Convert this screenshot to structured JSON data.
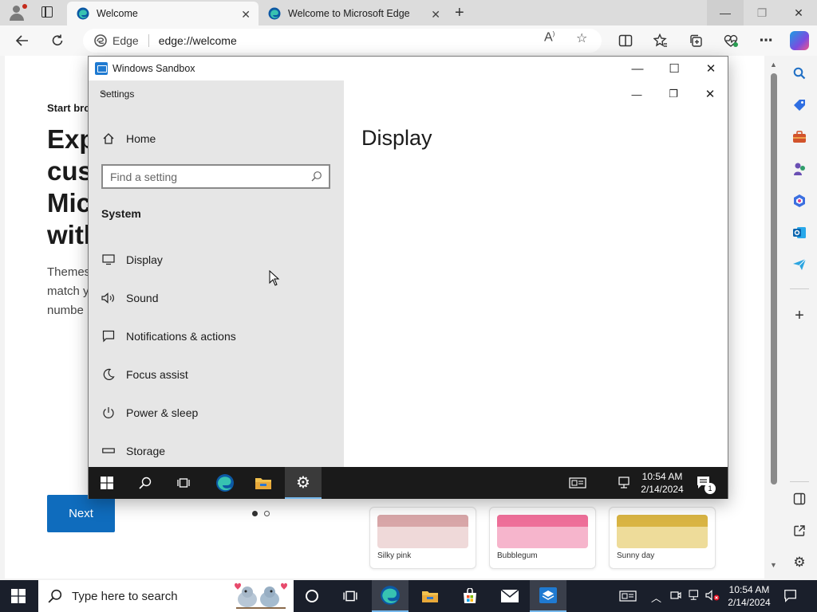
{
  "browser": {
    "tabs": [
      {
        "title": "Welcome",
        "active": true
      },
      {
        "title": "Welcome to Microsoft Edge",
        "active": false
      }
    ],
    "address": {
      "site_label": "Edge",
      "url": "edge://welcome"
    },
    "window_controls": {
      "minimize": "—",
      "restore": "❐",
      "close": "✕"
    }
  },
  "welcome_page": {
    "kicker": "Start bro",
    "hero_lines": [
      "Exp",
      "cust",
      "Mic",
      "with"
    ],
    "desc_lines": [
      "Themes",
      "match y",
      "numbe"
    ],
    "next_button": "Next",
    "themes": [
      {
        "name": "Silky pink",
        "color": "#e8c9c9",
        "tab": "#d8a6a8"
      },
      {
        "name": "Bubblegum",
        "color": "#f6b5cc",
        "tab": "#ee6f99"
      },
      {
        "name": "Sunny day",
        "color": "#eed88a",
        "tab": "#d9b443"
      }
    ]
  },
  "sandbox": {
    "title": "Windows Sandbox",
    "settings": {
      "app_title": "Settings",
      "home": "Home",
      "search_placeholder": "Find a setting",
      "group": "System",
      "page_title": "Display",
      "items": [
        {
          "label": "Display",
          "icon": "monitor-icon"
        },
        {
          "label": "Sound",
          "icon": "speaker-icon"
        },
        {
          "label": "Notifications & actions",
          "icon": "message-icon"
        },
        {
          "label": "Focus assist",
          "icon": "moon-icon"
        },
        {
          "label": "Power & sleep",
          "icon": "power-icon"
        },
        {
          "label": "Storage",
          "icon": "drive-icon"
        }
      ]
    },
    "taskbar": {
      "time": "10:54 AM",
      "date": "2/14/2024",
      "notification_count": "1"
    }
  },
  "host_taskbar": {
    "search_placeholder": "Type here to search",
    "time": "10:54 AM",
    "date": "2/14/2024"
  }
}
